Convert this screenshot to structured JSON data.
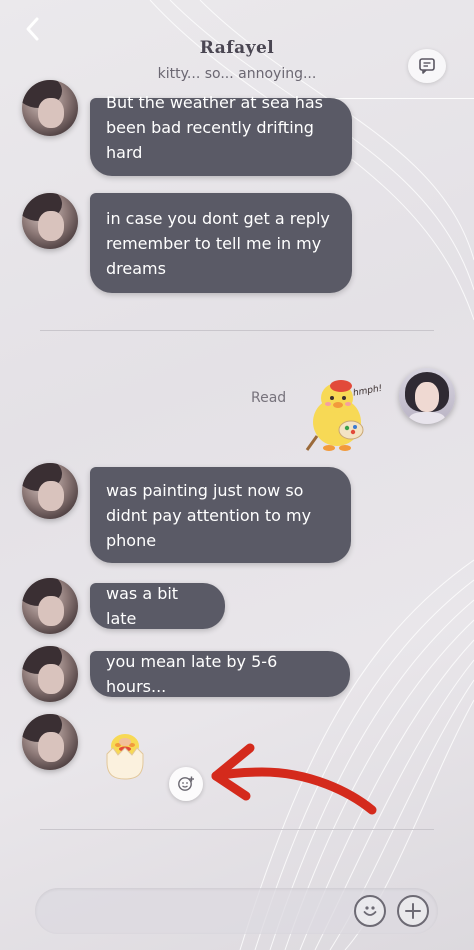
{
  "header": {
    "title": "Rafayel",
    "subtitle": "kitty... so... annoying..."
  },
  "messages": [
    {
      "lines": [
        "But the weather at sea has",
        "been bad recently drifting",
        "hard"
      ]
    },
    {
      "lines": [
        "in case you dont get a reply",
        "remember to tell me in my",
        "dreams"
      ]
    },
    {
      "lines": [
        "was painting just now so",
        "didnt pay attention to my",
        "phone"
      ]
    },
    {
      "lines": [
        "was a bit late"
      ]
    },
    {
      "lines": [
        "you mean late by 5-6 hours..."
      ]
    }
  ],
  "read_status": "Read",
  "sticker": {
    "caption": "hmph!"
  },
  "input": {
    "value": "",
    "placeholder": ""
  },
  "icons": {
    "back": "chevron-left-icon",
    "chat": "chat-bubble-icon",
    "sticker_add": "sticker-add-icon",
    "emoji": "emoji-icon",
    "plus": "plus-icon",
    "annotation": "red-arrow-annotation"
  },
  "colors": {
    "bubble": "#5a5a66",
    "bubble_text": "#ffffff",
    "annotation_arrow": "#d42a1c"
  }
}
